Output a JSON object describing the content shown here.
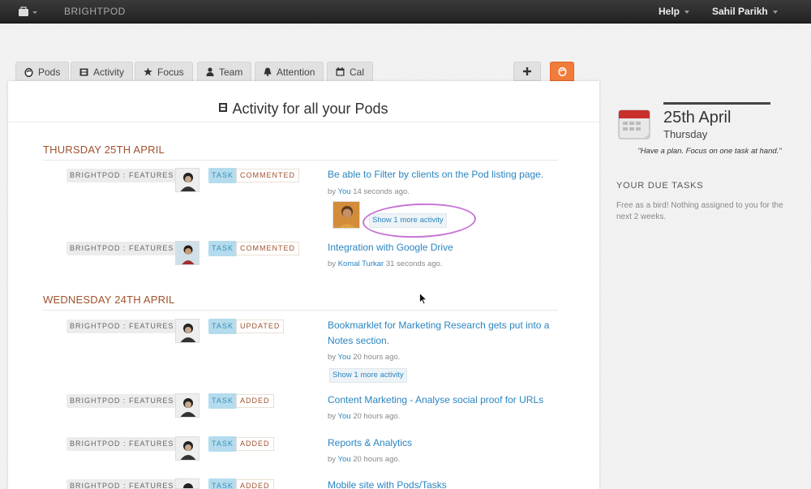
{
  "topbar": {
    "brand": "BRIGHTPOD",
    "help_label": "Help",
    "user_name": "Sahil Parikh"
  },
  "tabs": [
    {
      "label": "Pods",
      "icon": "pod-icon"
    },
    {
      "label": "Activity",
      "icon": "film-icon"
    },
    {
      "label": "Focus",
      "icon": "star-icon"
    },
    {
      "label": "Team",
      "icon": "user-icon"
    },
    {
      "label": "Attention",
      "icon": "bell-icon"
    },
    {
      "label": "Cal",
      "icon": "calendar-icon"
    }
  ],
  "main": {
    "title": "Activity for all your Pods",
    "days": [
      {
        "heading": "THURSDAY 25TH APRIL",
        "items": [
          {
            "pod": "BRIGHTPOD : FEATURES",
            "type": "TASK",
            "action": "COMMENTED",
            "title_lines": [
              "Be able to Filter by clients on the Pod listing page."
            ],
            "by": "by",
            "user": "You",
            "when": "14 seconds ago.",
            "more": "Show 1 more activity"
          },
          {
            "pod": "BRIGHTPOD : FEATURES",
            "type": "TASK",
            "action": "COMMENTED",
            "title_lines": [
              "Integration with Google Drive"
            ],
            "by": "by",
            "user": "Komal Turkar",
            "when": "31 seconds ago."
          }
        ]
      },
      {
        "heading": "WEDNESDAY 24TH APRIL",
        "items": [
          {
            "pod": "BRIGHTPOD : FEATURES",
            "type": "TASK",
            "action": "UPDATED",
            "title_lines": [
              "Bookmarklet for Marketing Research gets put into a",
              "Notes section."
            ],
            "by": "by",
            "user": "You",
            "when": "20 hours ago.",
            "more": "Show 1 more activity"
          },
          {
            "pod": "BRIGHTPOD : FEATURES",
            "type": "TASK",
            "action": "ADDED",
            "title_lines": [
              "Content Marketing - Analyse social proof for URLs"
            ],
            "by": "by",
            "user": "You",
            "when": "20 hours ago."
          },
          {
            "pod": "BRIGHTPOD : FEATURES",
            "type": "TASK",
            "action": "ADDED",
            "title_lines": [
              "Reports & Analytics"
            ],
            "by": "by",
            "user": "You",
            "when": "20 hours ago."
          },
          {
            "pod": "BRIGHTPOD : FEATURES",
            "type": "TASK",
            "action": "ADDED",
            "title_lines": [
              "Mobile site with Pods/Tasks"
            ]
          }
        ]
      }
    ]
  },
  "sidebar": {
    "date_big": "25th April",
    "date_day": "Thursday",
    "motto": "\"Have a plan. Focus on one task at hand.\"",
    "due_heading": "YOUR DUE TASKS",
    "due_text": "Free as a bird! Nothing assigned to you for the next 2 weeks."
  },
  "colors": {
    "accent_orange": "#f07b3a",
    "link_blue": "#2a85c0",
    "day_heading": "#a0522d",
    "task_badge": "#b4dcee",
    "highlight": "#c774d6"
  }
}
